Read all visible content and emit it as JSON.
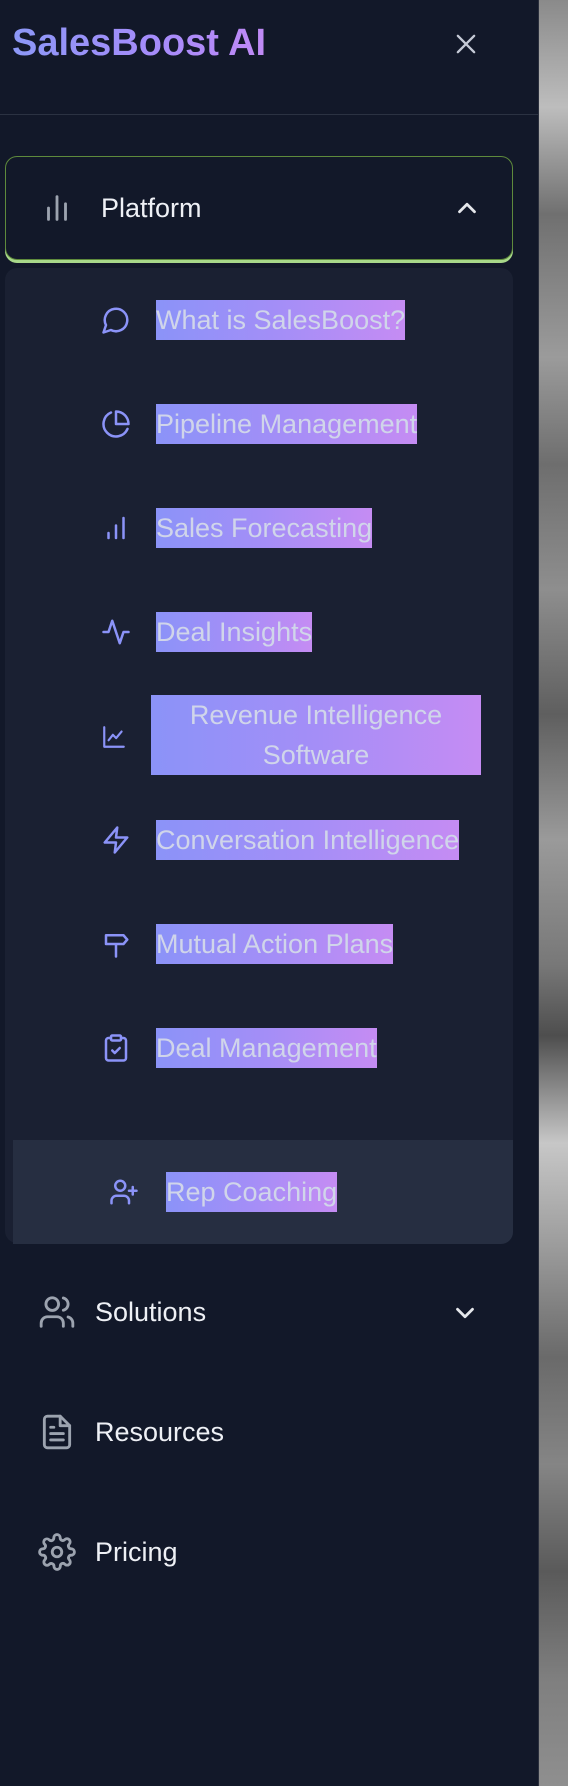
{
  "brand": {
    "name": "SalesBoost AI"
  },
  "nav": {
    "platform": {
      "label": "Platform",
      "expanded": true,
      "items": [
        {
          "label": "What is SalesBoost?",
          "icon": "message-circle-icon"
        },
        {
          "label": "Pipeline Management",
          "icon": "pie-chart-icon"
        },
        {
          "label": "Sales Forecasting",
          "icon": "bar-chart-icon"
        },
        {
          "label": "Deal Insights",
          "icon": "activity-icon"
        },
        {
          "label": "Revenue Intelligence Software",
          "icon": "line-chart-icon"
        },
        {
          "label": "Conversation Intelligence",
          "icon": "zap-icon"
        },
        {
          "label": "Mutual Action Plans",
          "icon": "signpost-icon"
        },
        {
          "label": "Deal Management",
          "icon": "clipboard-check-icon"
        },
        {
          "label": "Rep Coaching",
          "icon": "user-plus-icon"
        }
      ]
    },
    "solutions": {
      "label": "Solutions",
      "icon": "users-icon"
    },
    "resources": {
      "label": "Resources",
      "icon": "file-text-icon"
    },
    "pricing": {
      "label": "Pricing",
      "icon": "gear-icon"
    }
  },
  "colors": {
    "background": "#121829",
    "submenu_bg": "#1a2032",
    "active_bg": "#262e41",
    "accent_icon": "#8b93f8",
    "gradient_start": "#8b93f8",
    "gradient_end": "#c58cf3",
    "platform_border": "#5e8a3c"
  }
}
